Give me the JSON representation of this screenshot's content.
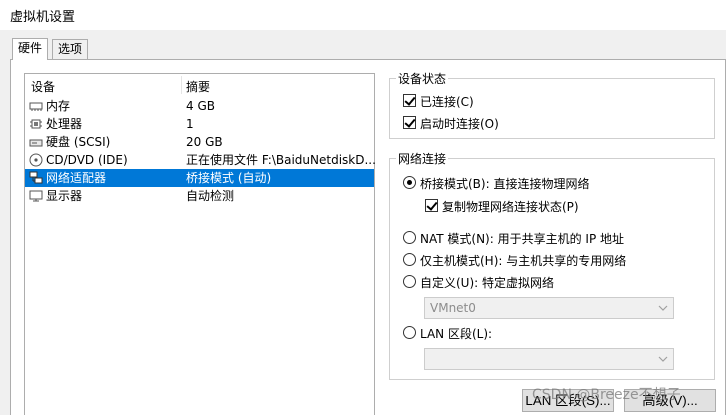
{
  "window": {
    "title": "虚拟机设置"
  },
  "tabs": [
    {
      "label": "硬件"
    },
    {
      "label": "选项"
    }
  ],
  "device_list": {
    "headers": {
      "device": "设备",
      "summary": "摘要"
    },
    "rows": [
      {
        "name": "内存",
        "summary": "4 GB",
        "icon": "memory-icon"
      },
      {
        "name": "处理器",
        "summary": "1",
        "icon": "processor-icon"
      },
      {
        "name": "硬盘 (SCSI)",
        "summary": "20 GB",
        "icon": "hard-disk-icon"
      },
      {
        "name": "CD/DVD (IDE)",
        "summary": "正在使用文件 F:\\BaiduNetdiskD...",
        "icon": "cd-dvd-icon"
      },
      {
        "name": "网络适配器",
        "summary": "桥接模式 (自动)",
        "icon": "network-adapter-icon",
        "selected": true
      },
      {
        "name": "显示器",
        "summary": "自动检测",
        "icon": "display-icon"
      }
    ]
  },
  "device_status": {
    "title": "设备状态",
    "connected": "已连接(C)",
    "connect_at_power_on": "启动时连接(O)"
  },
  "network_connection": {
    "title": "网络连接",
    "bridged": "桥接模式(B): 直接连接物理网络",
    "replicate_state": "复制物理网络连接状态(P)",
    "nat": "NAT 模式(N): 用于共享主机的 IP 地址",
    "host_only": "仅主机模式(H): 与主机共享的专用网络",
    "custom": "自定义(U): 特定虚拟网络",
    "custom_value": "VMnet0",
    "lan_segment": "LAN 区段(L):",
    "lan_value": ""
  },
  "buttons": {
    "lan_segments": "LAN 区段(S)...",
    "advanced": "高级(V)..."
  },
  "watermark": "CSDN @Breeze不想子"
}
